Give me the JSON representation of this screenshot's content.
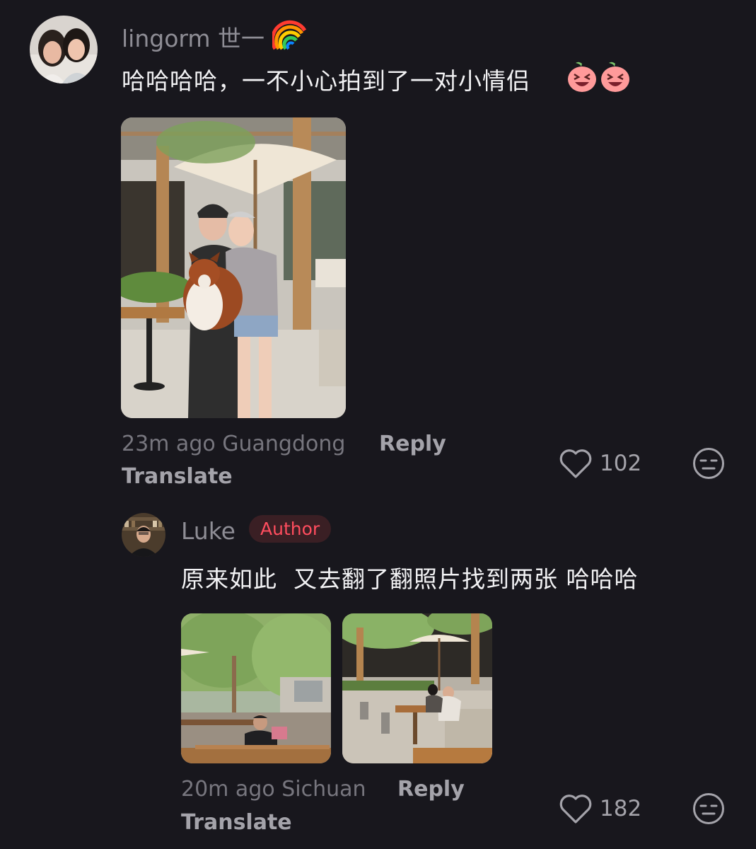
{
  "comments": [
    {
      "username": "lingorm 世一",
      "username_emoji": "rainbow-icon",
      "text": "哈哈哈哈，一不小心拍到了一对小情侣",
      "text_emojis": [
        "laughing-peach-emoji",
        "laughing-peach-emoji"
      ],
      "time": "23m ago",
      "location": "Guangdong",
      "reply_label": "Reply",
      "translate_label": "Translate",
      "likes": "102",
      "like_icon": "heart-outline-icon",
      "dislike_icon": "unamused-face-icon",
      "photos": [
        "photo-two-women-with-dog"
      ]
    },
    {
      "username": "Luke",
      "badge": "Author",
      "text": "原来如此  又去翻了翻照片找到两张 哈哈哈",
      "time": "20m ago",
      "location": "Sichuan",
      "reply_label": "Reply",
      "translate_label": "Translate",
      "likes": "182",
      "like_icon": "heart-outline-icon",
      "dislike_icon": "unamused-face-icon",
      "photos": [
        "photo-cafe-garden-left",
        "photo-cafe-garden-right"
      ]
    }
  ],
  "colors": {
    "background": "#18171d",
    "username": "#8e8d95",
    "text": "#f2f2f4",
    "meta": "#77767e",
    "action": "#a4a3aa",
    "author_badge_text": "#ff4d5e",
    "author_badge_bg": "#3a1f24"
  }
}
